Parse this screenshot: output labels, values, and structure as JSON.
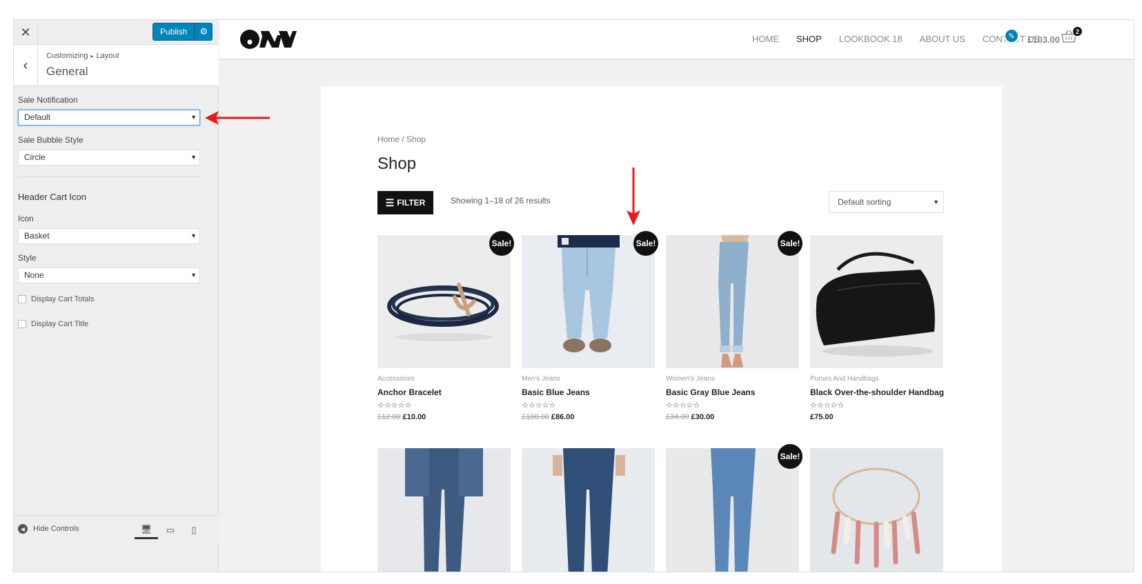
{
  "customizer": {
    "close_icon": "close-icon",
    "publish_label": "Publish",
    "gear_icon": "gear-icon",
    "breadcrumb": [
      "Customizing",
      "Layout"
    ],
    "section_title": "General",
    "sale_notification": {
      "label": "Sale Notification",
      "value": "Default"
    },
    "sale_bubble_style": {
      "label": "Sale Bubble Style",
      "value": "Circle"
    },
    "header_cart_icon_heading": "Header Cart Icon",
    "icon": {
      "label": "Icon",
      "value": "Basket"
    },
    "style": {
      "label": "Style",
      "value": "None"
    },
    "display_cart_totals": {
      "label": "Display Cart Totals",
      "checked": false
    },
    "display_cart_title": {
      "label": "Display Cart Title",
      "checked": false
    },
    "hide_controls": "Hide Controls"
  },
  "site": {
    "nav": [
      "HOME",
      "SHOP",
      "LOOKBOOK 18",
      "ABOUT US",
      "CONTACT US"
    ],
    "active_nav": "SHOP",
    "cart_total": "£103.00",
    "cart_count": "2"
  },
  "shop": {
    "breadcrumb": "Home / Shop",
    "title": "Shop",
    "filter_label": "FILTER",
    "results": "Showing 1–18 of 26 results",
    "sorting": "Default sorting",
    "sale_badge": "Sale!",
    "products": [
      {
        "category": "Accessories",
        "name": "Anchor Bracelet",
        "old_price": "£12.00",
        "price": "£10.00",
        "rating": "☆☆☆☆☆",
        "on_sale": true
      },
      {
        "category": "Men's Jeans",
        "name": "Basic Blue Jeans",
        "old_price": "£100.00",
        "price": "£86.00",
        "rating": "☆☆☆☆☆",
        "on_sale": true
      },
      {
        "category": "Women's Jeans",
        "name": "Basic Gray Blue Jeans",
        "old_price": "£34.00",
        "price": "£30.00",
        "rating": "☆☆☆☆☆",
        "on_sale": true
      },
      {
        "category": "Purses And Handbags",
        "name": "Black Over-the-shoulder Handbag",
        "old_price": "",
        "price": "£75.00",
        "rating": "☆☆☆☆☆",
        "on_sale": false
      }
    ]
  }
}
